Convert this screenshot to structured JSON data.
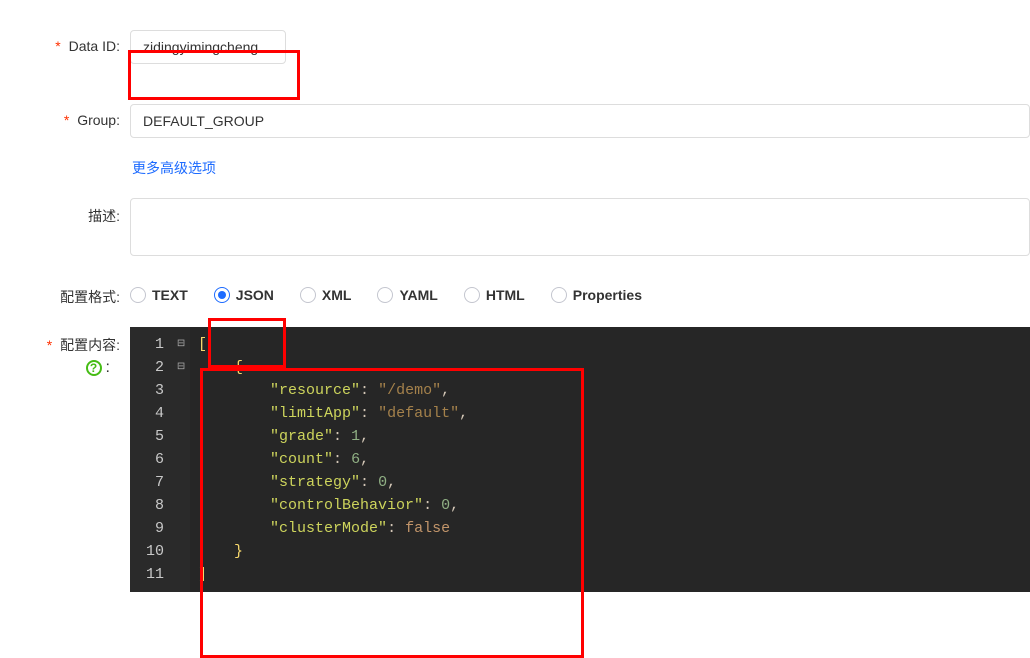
{
  "labels": {
    "dataId": "Data ID:",
    "group": "Group:",
    "moreOptions": "更多高级选项",
    "description": "描述:",
    "configFormat": "配置格式:",
    "configContent": "配置内容:"
  },
  "values": {
    "dataId": "zidingyimingcheng",
    "group": "DEFAULT_GROUP",
    "description": ""
  },
  "formats": {
    "items": [
      {
        "key": "TEXT",
        "label": "TEXT",
        "selected": false
      },
      {
        "key": "JSON",
        "label": "JSON",
        "selected": true
      },
      {
        "key": "XML",
        "label": "XML",
        "selected": false
      },
      {
        "key": "YAML",
        "label": "YAML",
        "selected": false
      },
      {
        "key": "HTML",
        "label": "HTML",
        "selected": false
      },
      {
        "key": "Properties",
        "label": "Properties",
        "selected": false
      }
    ]
  },
  "editor": {
    "lineNumbers": [
      "1",
      "2",
      "3",
      "4",
      "5",
      "6",
      "7",
      "8",
      "9",
      "10",
      "11"
    ],
    "content": [
      {
        "resource": "/demo",
        "limitApp": "default",
        "grade": 1,
        "count": 6,
        "strategy": 0,
        "controlBehavior": 0,
        "clusterMode": false
      }
    ],
    "tokens": {
      "l1_open": "[",
      "l2_brace": "    {",
      "l3_key": "\"resource\"",
      "l3_colon": ": ",
      "l3_val": "\"/demo\"",
      "l3_comma": ",",
      "l4_key": "\"limitApp\"",
      "l4_colon": ": ",
      "l4_val": "\"default\"",
      "l4_comma": ",",
      "l5_key": "\"grade\"",
      "l5_colon": ": ",
      "l5_val": "1",
      "l5_comma": ",",
      "l6_key": "\"count\"",
      "l6_colon": ": ",
      "l6_val": "6",
      "l6_comma": ",",
      "l7_key": "\"strategy\"",
      "l7_colon": ": ",
      "l7_val": "0",
      "l7_comma": ",",
      "l8_key": "\"controlBehavior\"",
      "l8_colon": ": ",
      "l8_val": "0",
      "l8_comma": ",",
      "l9_key": "\"clusterMode\"",
      "l9_colon": ": ",
      "l9_val": "false",
      "l10_brace": "    }",
      "l11_close": "]",
      "indent8": "        "
    }
  }
}
